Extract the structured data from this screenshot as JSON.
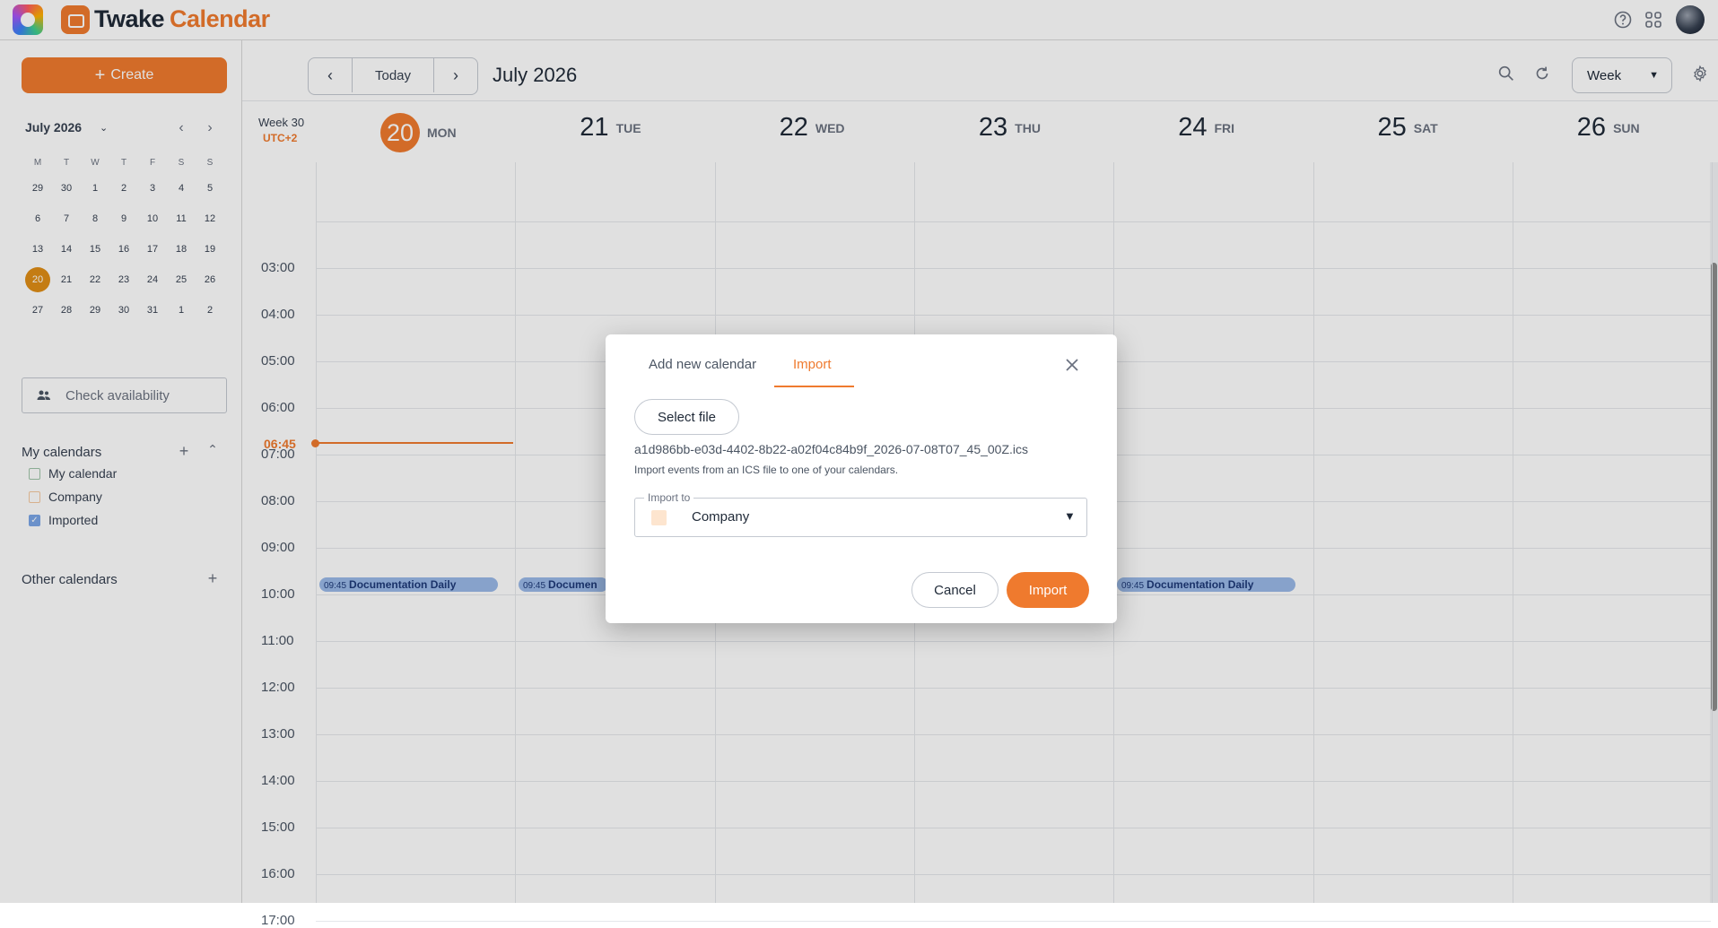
{
  "app": {
    "name_part1": "Twake",
    "name_part2": "Calendar"
  },
  "sidebar": {
    "create_label": "Create",
    "mini_calendar": {
      "title": "July 2026",
      "weekdays": [
        "M",
        "T",
        "W",
        "T",
        "F",
        "S",
        "S"
      ],
      "weeks": [
        [
          "29",
          "30",
          "1",
          "2",
          "3",
          "4",
          "5"
        ],
        [
          "6",
          "7",
          "8",
          "9",
          "10",
          "11",
          "12"
        ],
        [
          "13",
          "14",
          "15",
          "16",
          "17",
          "18",
          "19"
        ],
        [
          "20",
          "21",
          "22",
          "23",
          "24",
          "25",
          "26"
        ],
        [
          "27",
          "28",
          "29",
          "30",
          "31",
          "1",
          "2"
        ]
      ],
      "selected": "20"
    },
    "check_availability": "Check availability",
    "my_calendars_title": "My calendars",
    "my_calendars": [
      {
        "label": "My calendar",
        "color": "#9fc4a8",
        "checked": false
      },
      {
        "label": "Company",
        "color": "#f5c9a0",
        "checked": false
      },
      {
        "label": "Imported",
        "color": "#7aa6e6",
        "checked": true
      }
    ],
    "other_calendars_title": "Other calendars"
  },
  "toolbar": {
    "today_label": "Today",
    "period_title": "July 2026",
    "view_label": "Week"
  },
  "week": {
    "week_label": "Week 30",
    "timezone": "UTC+2",
    "days": [
      {
        "num": "20",
        "name": "MON",
        "today": true
      },
      {
        "num": "21",
        "name": "TUE"
      },
      {
        "num": "22",
        "name": "WED"
      },
      {
        "num": "23",
        "name": "THU"
      },
      {
        "num": "24",
        "name": "FRI"
      },
      {
        "num": "25",
        "name": "SAT"
      },
      {
        "num": "26",
        "name": "SUN"
      }
    ],
    "hours": [
      "03:00",
      "04:00",
      "05:00",
      "06:00",
      "07:00",
      "08:00",
      "09:00",
      "10:00",
      "11:00",
      "12:00",
      "13:00",
      "14:00",
      "15:00",
      "16:00",
      "17:00"
    ],
    "now_time": "06:45",
    "events": [
      {
        "time": "09:45",
        "title": "Documentation Daily",
        "day": 0
      },
      {
        "time": "09:45",
        "title": "Documen",
        "day": 1
      },
      {
        "time": "09:45",
        "title": "Documentation Daily",
        "day": 4
      }
    ]
  },
  "modal": {
    "tab_add": "Add new calendar",
    "tab_import": "Import",
    "select_file_label": "Select file",
    "file_name": "a1d986bb-e03d-4402-8b22-a02f04c84b9f_2026-07-08T07_45_00Z.ics",
    "help_text": "Import events from an ICS file to one of your calendars.",
    "import_to_label": "Import to",
    "import_to_value": "Company",
    "import_to_color": "#fde5cf",
    "cancel_label": "Cancel",
    "import_label": "Import"
  }
}
